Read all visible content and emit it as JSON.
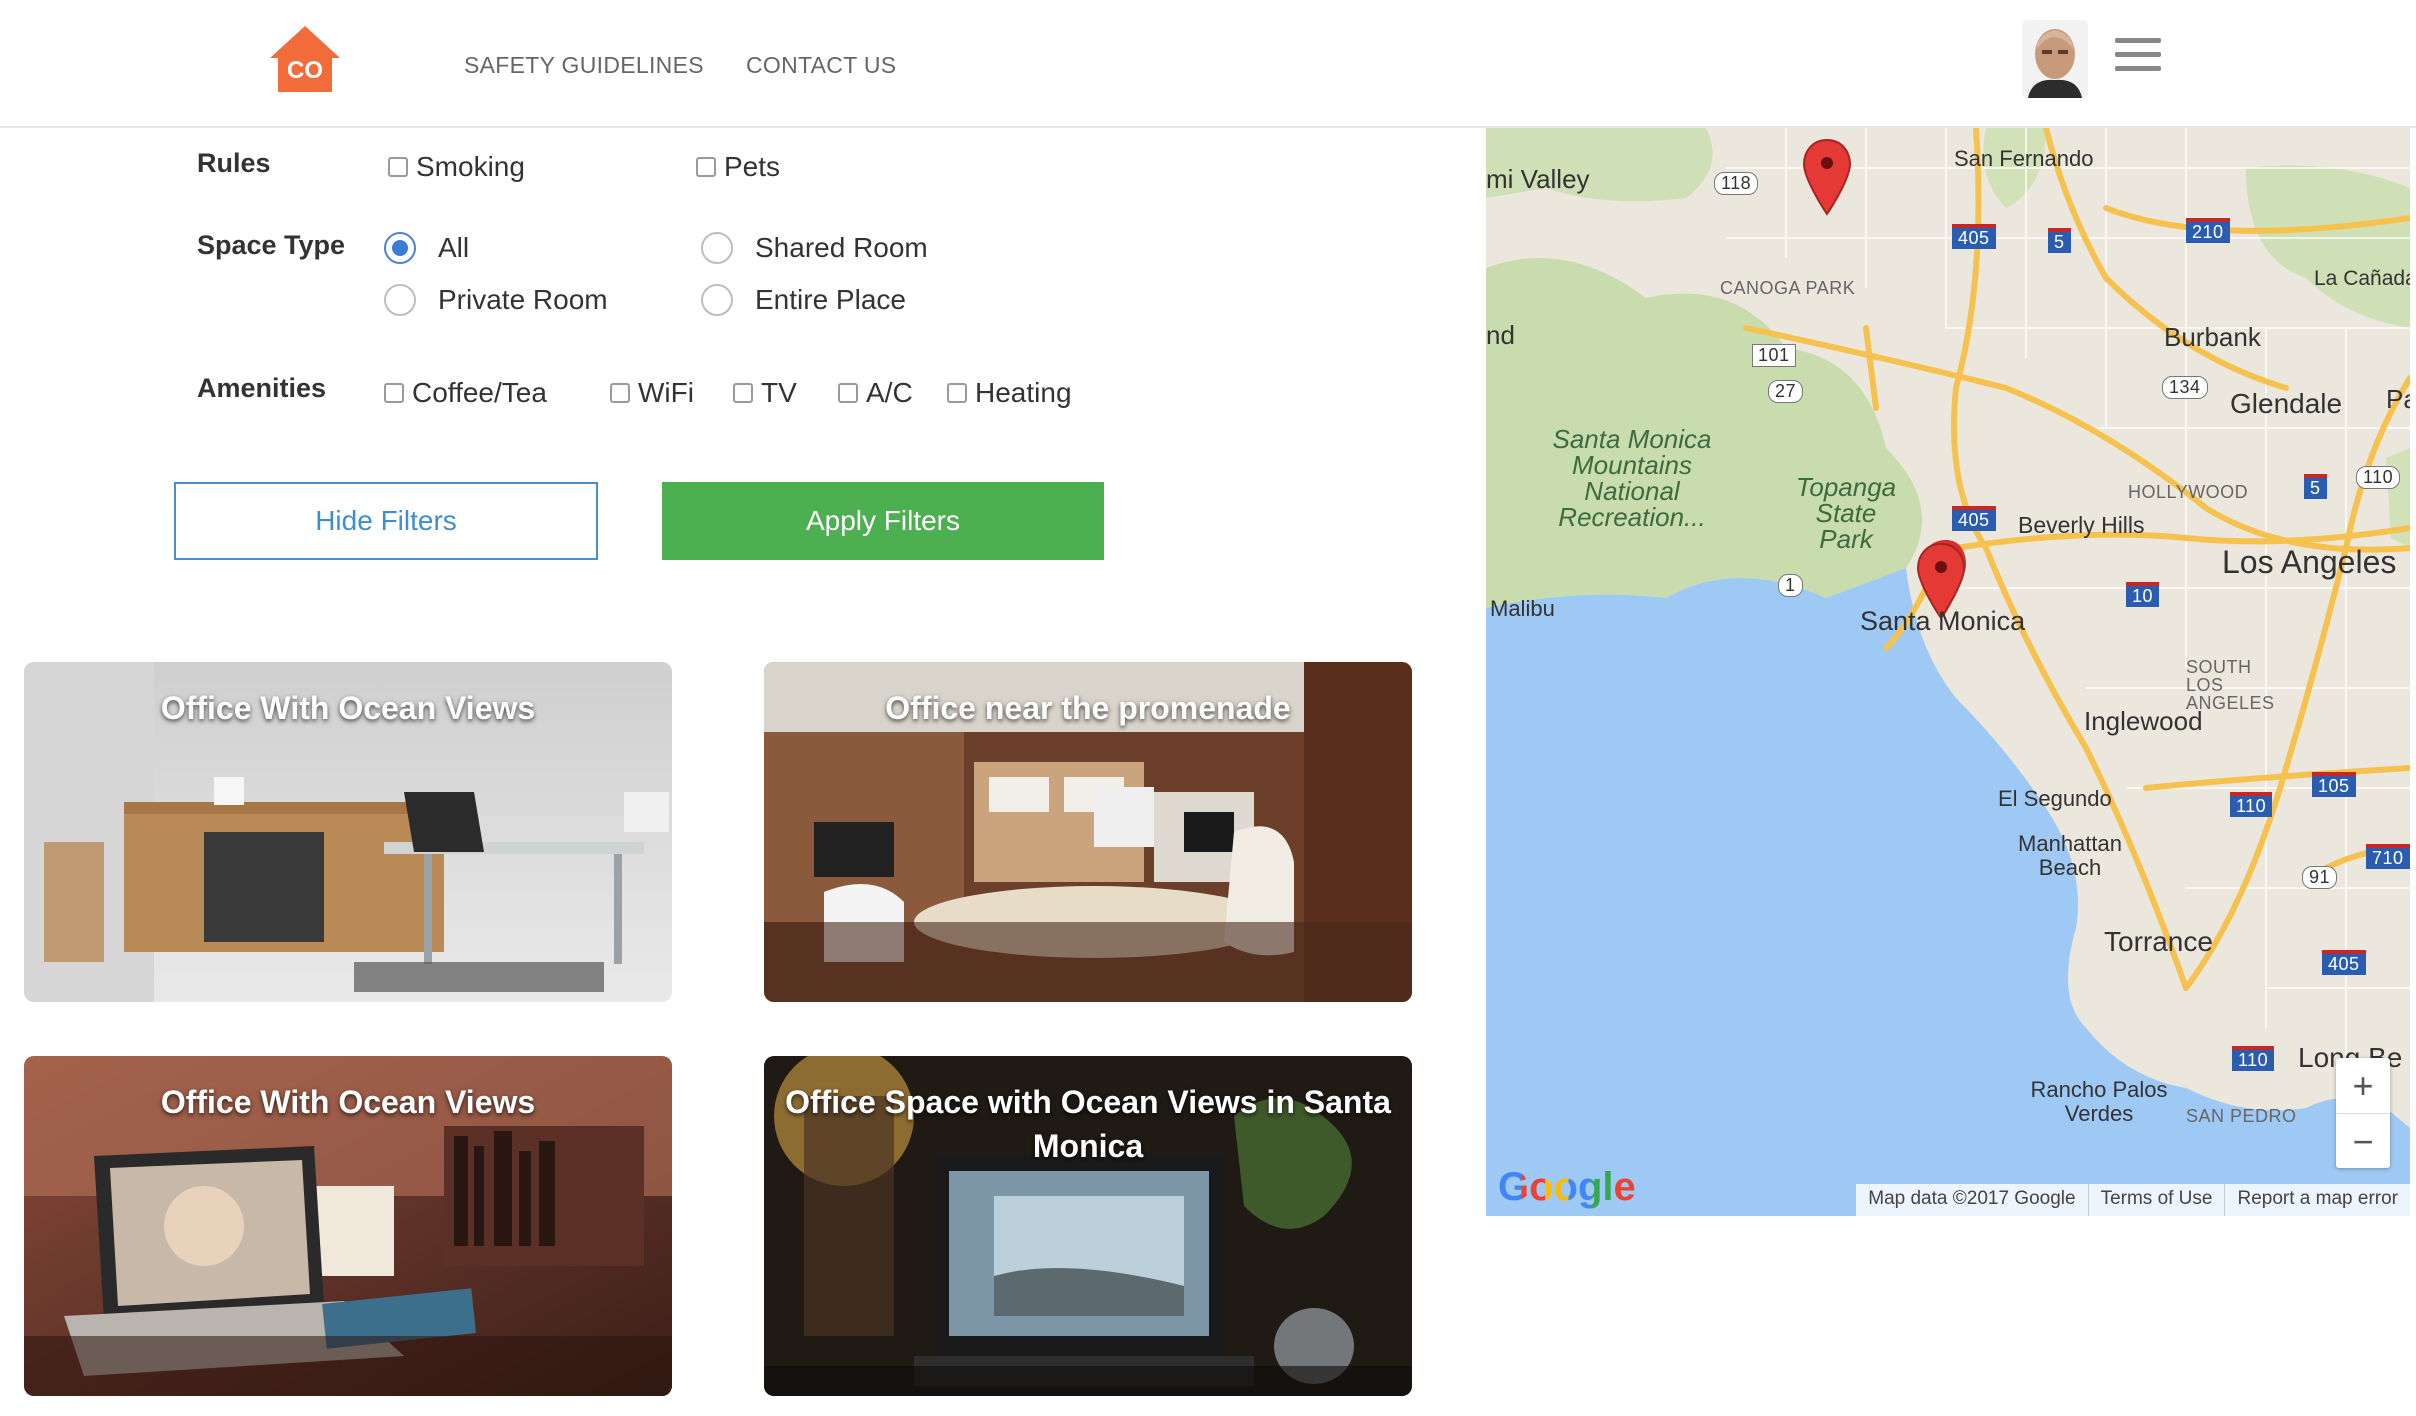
{
  "header": {
    "logo_text": "CO",
    "nav": [
      "SAFETY GUIDELINES",
      "CONTACT US"
    ],
    "brand_color": "#f26b3a"
  },
  "filters": {
    "rules_label": "Rules",
    "rules": [
      "Smoking",
      "Pets"
    ],
    "space_type_label": "Space Type",
    "space_types": [
      "All",
      "Shared Room",
      "Private Room",
      "Entire Place"
    ],
    "space_type_selected": "All",
    "amenities_label": "Amenities",
    "amenities": [
      "Coffee/Tea",
      "WiFi",
      "TV",
      "A/C",
      "Heating"
    ],
    "hide_button": "Hide Filters",
    "apply_button": "Apply Filters",
    "apply_color": "#4caf50"
  },
  "listings": [
    {
      "title": "Office With Ocean Views"
    },
    {
      "title": "Office near the promenade"
    },
    {
      "title": "Office With Ocean Views"
    },
    {
      "title": "Office Space with Ocean Views in Santa Monica"
    }
  ],
  "map": {
    "places": [
      "mi Valley",
      "San Fernando",
      "CANOGA PARK",
      "La Cañada Flintridge",
      "Burbank",
      "Glendale",
      "Pa",
      "Santa Monica Mountains National Recreation...",
      "Topanga State Park",
      "HOLLYWOOD",
      "Beverly Hills",
      "Los Angeles",
      "Malibu",
      "Santa Monica",
      "SOUTH LOS ANGELES",
      "Inglewood",
      "El Segundo",
      "Manhattan Beach",
      "Torrance",
      "Long Be",
      "Rancho Palos Verdes",
      "SAN PEDRO",
      "nd"
    ],
    "highways": [
      "118",
      "405",
      "5",
      "210",
      "101",
      "27",
      "134",
      "110",
      "5",
      "405",
      "1",
      "10",
      "105",
      "110",
      "710",
      "91",
      "405",
      "110"
    ],
    "zoom_in": "+",
    "zoom_out": "−",
    "footer": [
      "Map data ©2017 Google",
      "Terms of Use",
      "Report a map error"
    ],
    "google_logo": "Google"
  }
}
